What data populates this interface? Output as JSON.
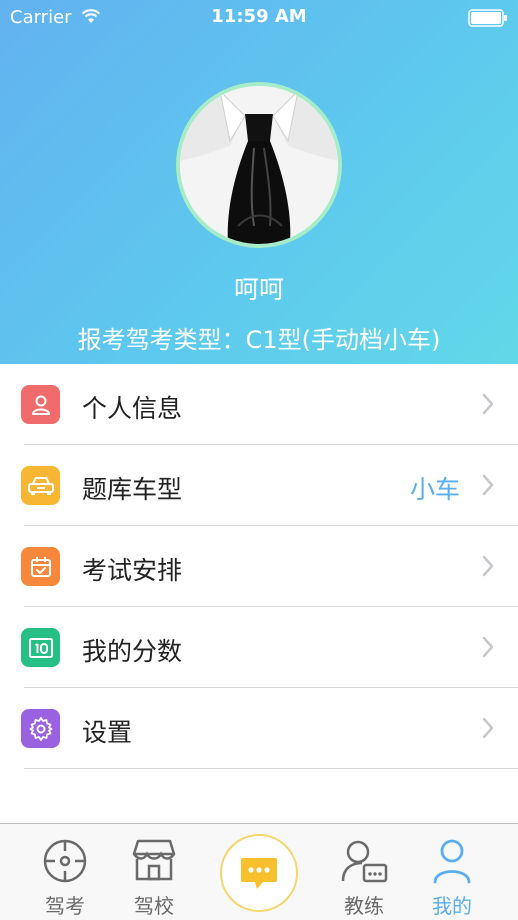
{
  "status_bar": {
    "carrier": "Carrier",
    "time": "11:59 AM"
  },
  "profile": {
    "nickname": "呵呵",
    "exam_type": "报考驾考类型：C1型(手动档小车)"
  },
  "menu": {
    "items": [
      {
        "label": "个人信息",
        "value": "",
        "icon": "person-icon",
        "color": "#f06b6b"
      },
      {
        "label": "题库车型",
        "value": "小车",
        "icon": "car-icon",
        "color": "#f8b733"
      },
      {
        "label": "考试安排",
        "value": "",
        "icon": "calendar-icon",
        "color": "#f7873a"
      },
      {
        "label": "我的分数",
        "value": "",
        "icon": "score-icon",
        "color": "#26bf86"
      },
      {
        "label": "设置",
        "value": "",
        "icon": "settings-icon",
        "color": "#9a62e0"
      }
    ]
  },
  "tabbar": {
    "tabs": [
      {
        "label": "驾考",
        "icon": "crosshair-icon",
        "active": false
      },
      {
        "label": "驾校",
        "icon": "shop-icon",
        "active": false
      },
      {
        "label": "",
        "icon": "message-icon",
        "active": false
      },
      {
        "label": "教练",
        "icon": "coach-icon",
        "active": false
      },
      {
        "label": "我的",
        "icon": "person-icon",
        "active": true
      }
    ]
  },
  "colors": {
    "header_gradient_start": "#62b2f0",
    "header_gradient_end": "#61d8e8",
    "accent": "#5aaef0",
    "center_button": "#f8c02d"
  }
}
